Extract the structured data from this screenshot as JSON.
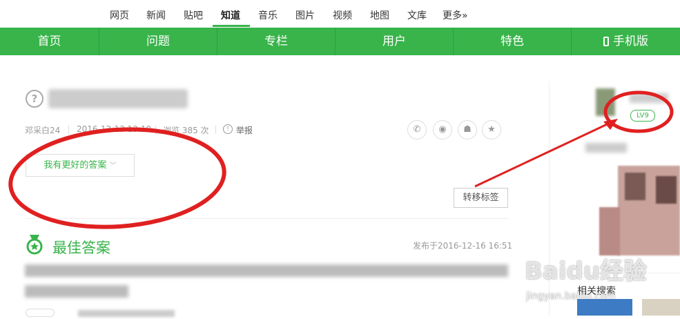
{
  "top_nav": {
    "items": [
      "网页",
      "新闻",
      "贴吧",
      "知道",
      "音乐",
      "图片",
      "视频",
      "地图",
      "文库",
      "更多»"
    ],
    "active": "知道"
  },
  "green_nav": {
    "items": [
      "首页",
      "问题",
      "专栏",
      "用户",
      "特色"
    ],
    "mobile": "手机版"
  },
  "question": {
    "meta": {
      "author": "邓采白24",
      "date": "2016-12-13 13:10",
      "views": "浏览 385 次",
      "report": "举报"
    },
    "better_answer_btn": "我有更好的答案",
    "transfer_btn": "转移标签"
  },
  "best_answer": {
    "title": "最佳答案",
    "published": "发布于2016-12-16 16:51"
  },
  "sidebar": {
    "level": "LV9",
    "related": "相关搜索"
  },
  "watermark": {
    "logo": "Baidu经验",
    "url": "jingyan.baidu.com"
  },
  "colors": {
    "accent": "#38b44a",
    "annotation": "#e02020"
  }
}
